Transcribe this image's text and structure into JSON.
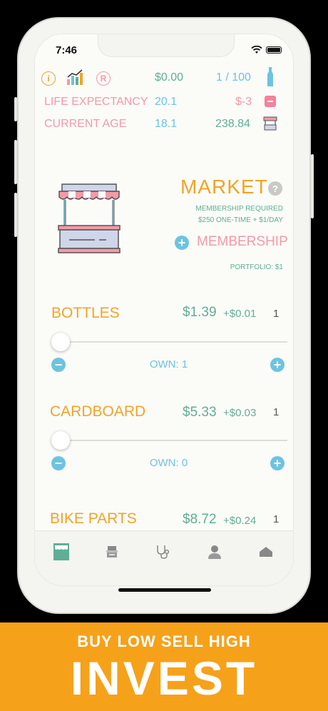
{
  "status_bar": {
    "time": "7:46"
  },
  "stats": {
    "money": "$0.00",
    "capacity": "1 / 100",
    "life_expectancy_label": "LIFE EXPECTANCY",
    "life_expectancy_value": "20.1",
    "life_expectancy_delta": "$-3",
    "current_age_label": "CURRENT AGE",
    "current_age_value": "18.1",
    "current_age_extra": "238.84"
  },
  "market": {
    "title": "MARKET",
    "help": "?",
    "membership_required": "MEMBERSHIP REQUIRED",
    "membership_price": "$250 ONE-TIME + $1/DAY",
    "membership_button": "MEMBERSHIP",
    "portfolio": "PORTFOLIO: $1"
  },
  "assets": [
    {
      "name": "BOTTLES",
      "price": "$1.39",
      "delta": "+$0.01",
      "qty": "1",
      "own": "OWN: 1",
      "slider_level": 0
    },
    {
      "name": "CARDBOARD",
      "price": "$5.33",
      "delta": "+$0.03",
      "qty": "1",
      "own": "OWN: 0",
      "slider_level": 0
    },
    {
      "name": "BIKE PARTS",
      "price": "$8.72",
      "delta": "+$0.24",
      "qty": "1"
    }
  ],
  "tabs": [
    "market-tab",
    "shop-tab",
    "health-tab",
    "profile-tab",
    "home-tab"
  ],
  "banner": {
    "subtitle": "BUY LOW SELL HIGH",
    "title": "INVEST"
  },
  "colors": {
    "accent": "#f0a429",
    "pink": "#f39aa6",
    "blue": "#6dc3e0",
    "green": "#5fae96",
    "banner": "#f6a11a"
  }
}
